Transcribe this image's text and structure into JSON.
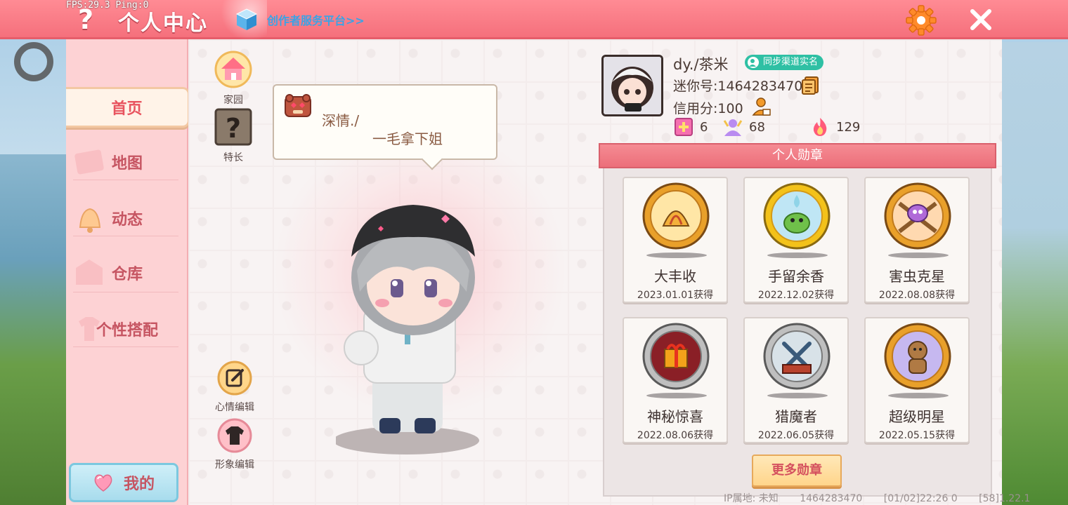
{
  "overlay": {
    "fps": "FPS:29.3  Ping:0"
  },
  "header": {
    "help": "?",
    "title": "个人中心",
    "creator_link": "创作者服务平台>>"
  },
  "nav": {
    "items": [
      {
        "label": "首页",
        "active": true
      },
      {
        "label": "地图",
        "active": false
      },
      {
        "label": "动态",
        "active": false
      },
      {
        "label": "仓库",
        "active": false
      },
      {
        "label": "个性搭配",
        "active": false
      }
    ],
    "mine": "我的"
  },
  "tools": {
    "home": "家园",
    "talent": "特长",
    "talent_glyph": "?",
    "mood_edit": "心情编辑",
    "look_edit": "形象编辑"
  },
  "mood": {
    "line1": "深情./",
    "line2": "一毛拿下姐"
  },
  "profile": {
    "name": "dy./茶米",
    "sync_badge": "同步渠道实名",
    "mini_id": "迷你号:1464283470",
    "credit": "信用分:100",
    "stats": [
      {
        "icon": "level-badge-icon",
        "value": "6"
      },
      {
        "icon": "popularity-icon",
        "value": "68"
      },
      {
        "icon": "flame-icon",
        "value": "129"
      }
    ]
  },
  "medals": {
    "title": "个人勋章",
    "items": [
      {
        "name": "大丰收",
        "date": "2023.01.01获得",
        "tier": "gold"
      },
      {
        "name": "手留余香",
        "date": "2022.12.02获得",
        "tier": "gold"
      },
      {
        "name": "害虫克星",
        "date": "2022.08.08获得",
        "tier": "gold"
      },
      {
        "name": "神秘惊喜",
        "date": "2022.08.06获得",
        "tier": "silver"
      },
      {
        "name": "猎魔者",
        "date": "2022.06.05获得",
        "tier": "silver"
      },
      {
        "name": "超级明星",
        "date": "2022.05.15获得",
        "tier": "gold"
      }
    ],
    "more": "更多勋章"
  },
  "footer": {
    "ip": "IP属地: 未知",
    "uid": "1464283470",
    "time": "[01/02]22:26 0",
    "version": "[58]1.22.1"
  },
  "colors": {
    "topbar": "#f5707c",
    "nav_bg": "#fdd2d4",
    "nav_text": "#c65562",
    "medal_head": "#ec6f7a",
    "sync_badge": "#2fc0a4",
    "creator_link": "#3aa3e6"
  }
}
